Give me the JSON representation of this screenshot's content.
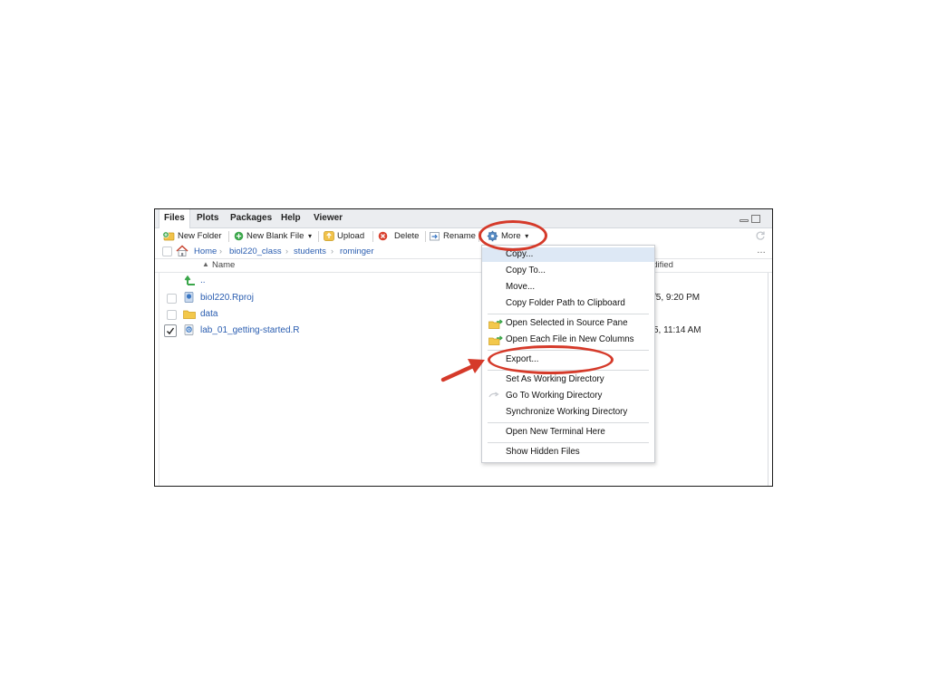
{
  "tabs": [
    "Files",
    "Plots",
    "Packages",
    "Help",
    "Viewer"
  ],
  "toolbar": {
    "new_folder": "New Folder",
    "new_blank_file": "New Blank File",
    "upload": "Upload",
    "delete": "Delete",
    "rename": "Rename",
    "more": "More"
  },
  "breadcrumb": [
    "Home",
    "biol220_class",
    "students",
    "rominger"
  ],
  "columns": {
    "name": "Name",
    "modified": "Modified"
  },
  "files": [
    {
      "name": "..",
      "modified": "",
      "checked": false,
      "icon": "up-arrow-icon"
    },
    {
      "name": "biol220.Rproj",
      "modified": "/5, 9:20 PM",
      "checked": false,
      "icon": "rproj-icon"
    },
    {
      "name": "data",
      "modified": "",
      "checked": false,
      "icon": "folder-icon"
    },
    {
      "name": "lab_01_getting-started.R",
      "modified": "5, 11:14 AM",
      "checked": true,
      "icon": "r-script-icon"
    }
  ],
  "more_menu": {
    "items": [
      {
        "label": "Copy...",
        "highlighted": true
      },
      {
        "label": "Copy To..."
      },
      {
        "label": "Move..."
      },
      {
        "label": "Copy Folder Path to Clipboard"
      },
      {
        "label": "Open Selected in Source Pane",
        "icon": "open-source-icon"
      },
      {
        "label": "Open Each File in New Columns",
        "icon": "open-columns-icon"
      },
      {
        "label": "Export..."
      },
      {
        "label": "Set As Working Directory"
      },
      {
        "label": "Go To Working Directory",
        "icon": "goto-arrow-icon"
      },
      {
        "label": "Synchronize Working Directory"
      },
      {
        "label": "Open New Terminal Here"
      },
      {
        "label": "Show Hidden Files"
      }
    ]
  },
  "colors": {
    "link": "#2a5db0",
    "annotation_red": "#d53a2a",
    "menu_highlight": "#dde8f5"
  }
}
